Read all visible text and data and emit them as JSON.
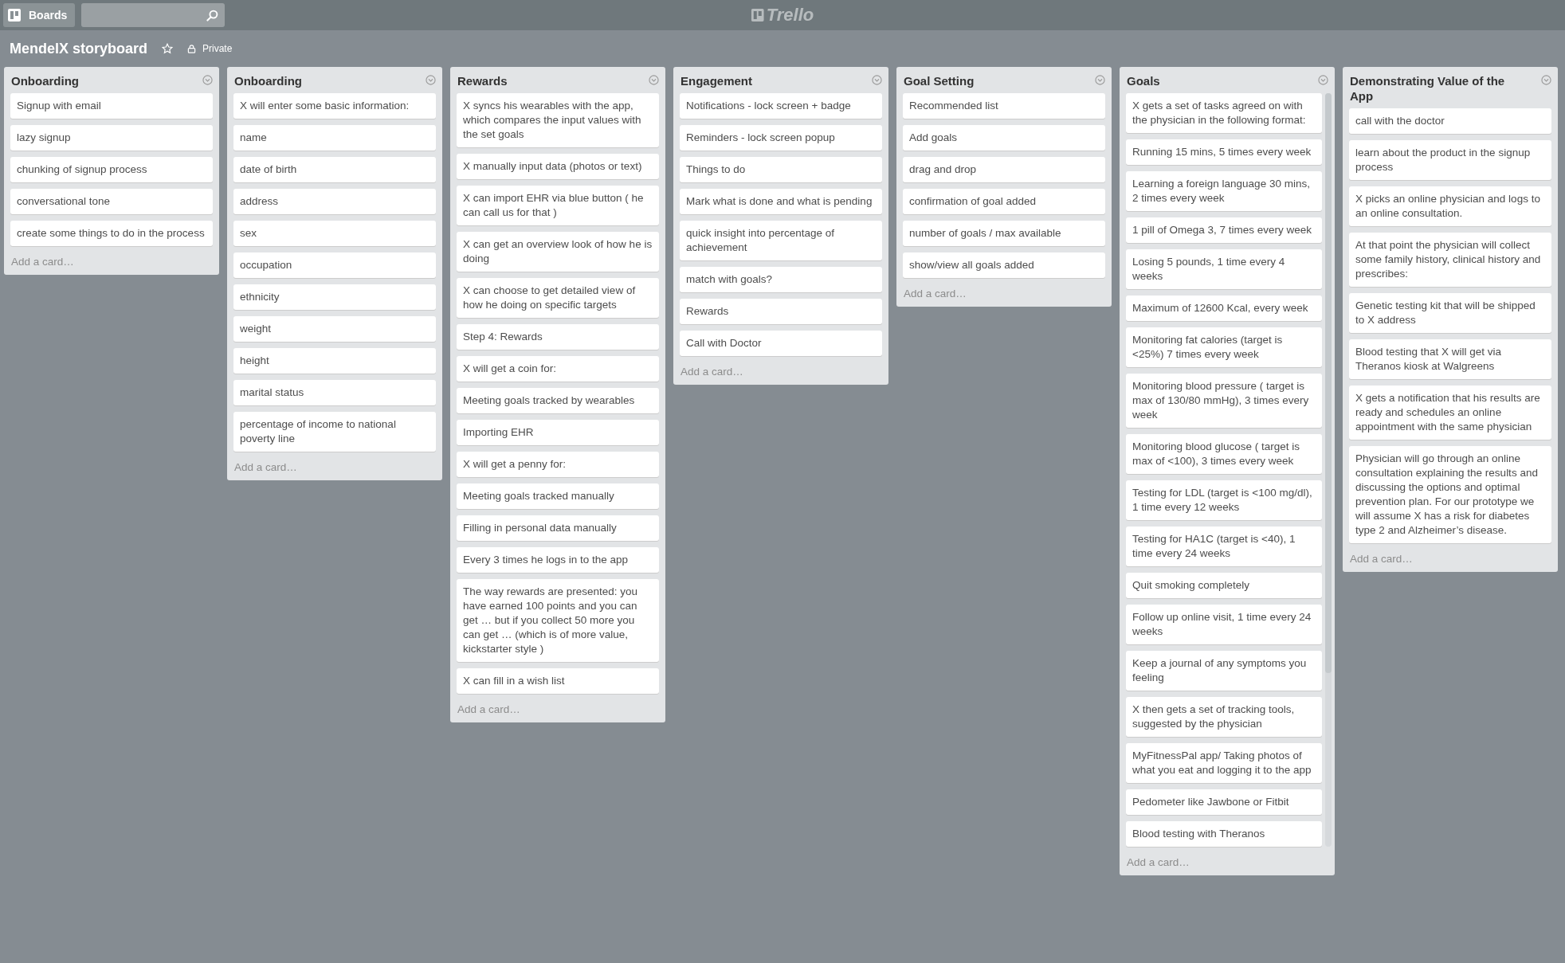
{
  "header": {
    "boards_button": "Boards",
    "logo": "Trello"
  },
  "board": {
    "title": "MendelX storyboard",
    "visibility": "Private"
  },
  "lists": [
    {
      "title": "Onboarding",
      "add_card": "Add a card…",
      "scrolled": false,
      "cards": [
        "Signup with email",
        "lazy signup",
        "chunking of signup process",
        "conversational tone",
        "create some things to do in the process"
      ]
    },
    {
      "title": "Onboarding",
      "add_card": "Add a card…",
      "scrolled": false,
      "cards": [
        "X will enter some basic information:",
        "name",
        "date of birth",
        "address",
        "sex",
        "occupation",
        "ethnicity",
        "weight",
        "height",
        "marital status",
        "percentage of income to national poverty line"
      ]
    },
    {
      "title": "Rewards",
      "add_card": "Add a card…",
      "scrolled": false,
      "cards": [
        "X syncs his wearables with the app, which compares the input values with the set goals",
        "X manually input data (photos or text)",
        "X can import EHR via blue button ( he can call us for that )",
        "X can get an overview look of how he is doing",
        "X can choose to get detailed view of how he doing on specific targets",
        "Step 4: Rewards",
        "X will get a coin for:",
        "Meeting goals tracked by wearables",
        "Importing EHR",
        "X will get a penny for:",
        "Meeting goals tracked manually",
        "Filling in personal data manually",
        "Every 3 times he logs in to the app",
        "The way rewards are presented: you have earned 100 points and you can get … but if you collect 50 more you can get … (which is of more value, kickstarter style )",
        "X can fill in a wish list"
      ]
    },
    {
      "title": "Engagement",
      "add_card": "Add a card…",
      "scrolled": false,
      "cards": [
        "Notifications - lock screen + badge",
        "Reminders - lock screen popup",
        "Things to do",
        "Mark what is done and what is pending",
        "quick insight into percentage of achievement",
        "match with goals?",
        "Rewards",
        "Call with Doctor"
      ]
    },
    {
      "title": "Goal Setting",
      "add_card": "Add a card…",
      "scrolled": false,
      "cards": [
        "Recommended list",
        "Add goals",
        "drag and drop",
        "confirmation of goal added",
        "number of goals / max available",
        "show/view all goals added"
      ]
    },
    {
      "title": "Goals",
      "add_card": "Add a card…",
      "scrolled": true,
      "cards": [
        "X gets a set of tasks agreed on with the physician in the following format:",
        "Running 15 mins, 5 times every week",
        "Learning a foreign language 30 mins, 2 times every week",
        "1 pill of Omega 3, 7 times every week",
        "Losing 5 pounds, 1 time every 4 weeks",
        "Maximum of 12600 Kcal, every week",
        "Monitoring fat calories (target is <25%) 7 times every week",
        "Monitoring blood pressure ( target is max of 130/80 mmHg), 3 times every week",
        "Monitoring blood glucose ( target is max of <100), 3 times every week",
        "Testing for LDL (target is <100 mg/dl), 1 time every 12 weeks",
        "Testing for HA1C (target is <40), 1 time every 24 weeks",
        "Quit smoking completely",
        "Follow up online visit, 1 time every 24 weeks",
        "Keep a journal of any symptoms you feeling",
        "X then gets a set of tracking tools, suggested by the physician",
        "MyFitnessPal app/ Taking photos of what you eat and logging it to the app",
        "Pedometer like Jawbone or Fitbit",
        "Blood testing with Theranos"
      ]
    },
    {
      "title": "Demonstrating Value of the App",
      "add_card": "Add a card…",
      "scrolled": false,
      "cards": [
        "call with the doctor",
        "learn about the product in the signup process",
        "X picks an online physician and logs to an online consultation.",
        "At that point the physician will collect some family history, clinical history and prescribes:",
        "Genetic testing kit that will be shipped to X address",
        "Blood testing that X will get via Theranos kiosk at Walgreens",
        "X gets a notification that his results are ready and schedules an online appointment with the same physician",
        "Physician will go through an online consultation explaining the results and discussing the options and optimal prevention plan. For our prototype we will assume X has a risk for diabetes type 2 and Alzheimer’s disease."
      ]
    }
  ]
}
